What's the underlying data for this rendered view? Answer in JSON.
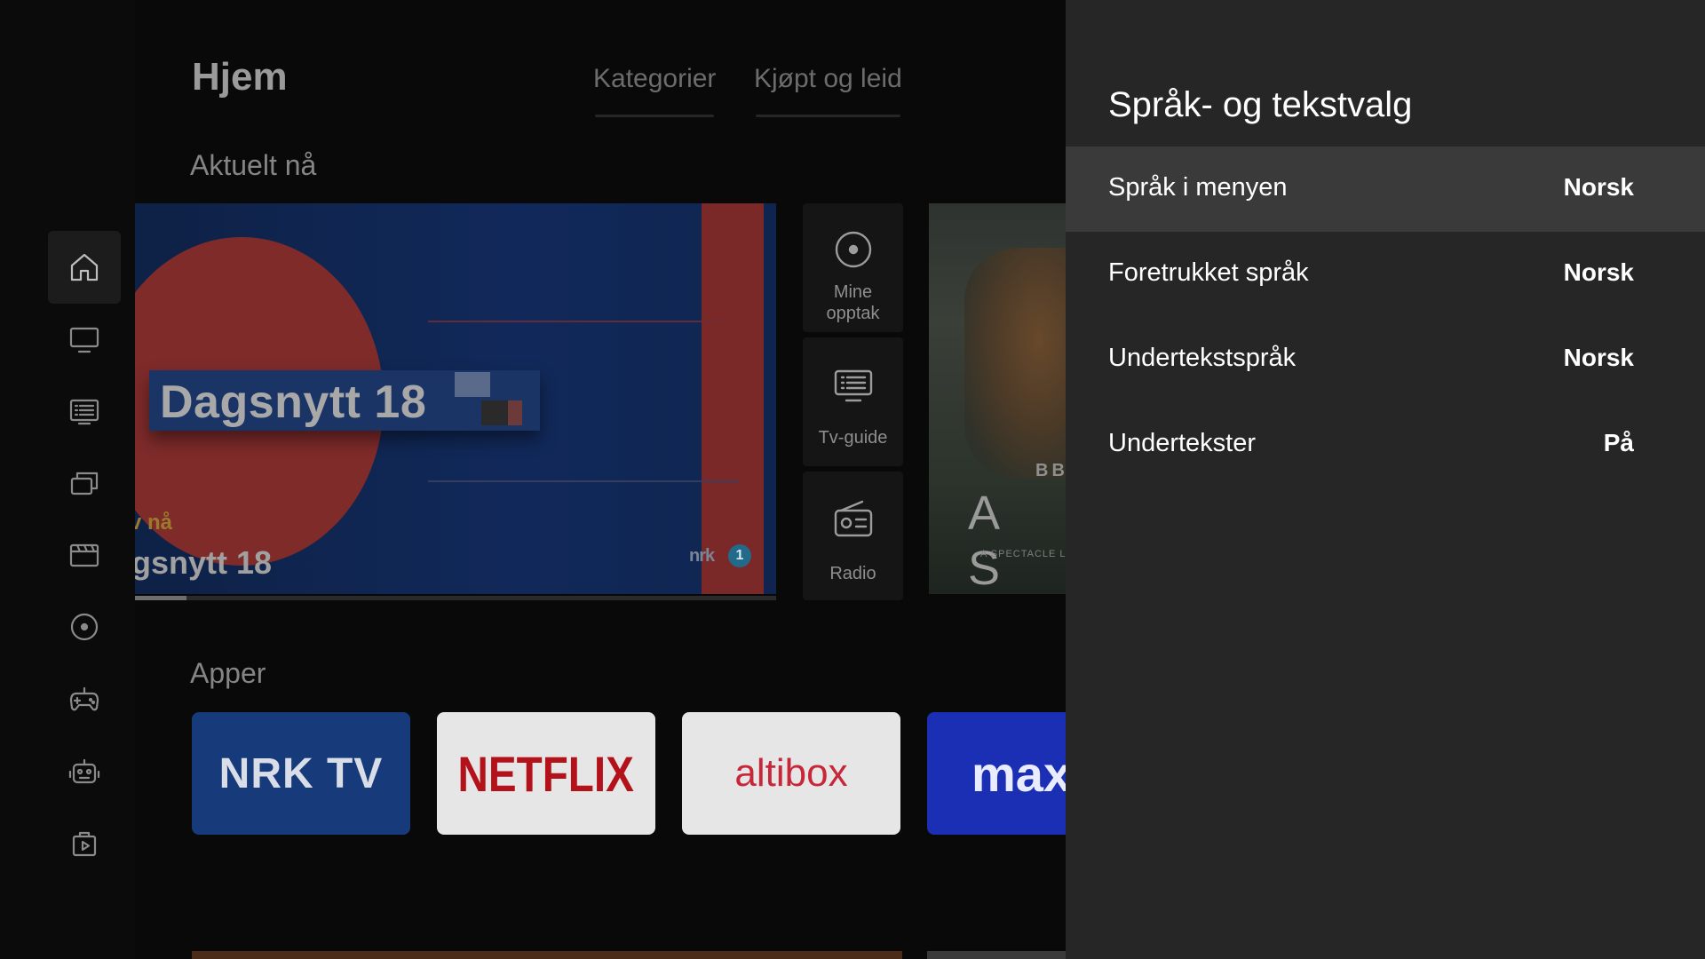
{
  "home": {
    "title": "Hjem",
    "tabs": [
      "Kategorier",
      "Kjøpt og leid"
    ],
    "section_now": "Aktuelt nå",
    "section_apps": "Apper"
  },
  "hero": {
    "plate_text": "Dagsnytt 18",
    "live_label": "v nå",
    "show_title": "gsnytt 18",
    "channel_logo": "nrk",
    "channel_number": "1",
    "progress": 0.08
  },
  "shortcuts": [
    {
      "label": "Mine opptak",
      "icon": "record-icon"
    },
    {
      "label": "Tv-guide",
      "icon": "tv-guide-icon"
    },
    {
      "label": "Radio",
      "icon": "radio-icon"
    }
  ],
  "side_card": {
    "network": "BBC",
    "title_partial": "A S",
    "tagline_partial": "A SPECTACLE L"
  },
  "apps": [
    {
      "name": "NRK TV",
      "bg": "#173a7a",
      "fg": "#d8dde8"
    },
    {
      "name": "NETFLIX",
      "bg": "#e6e6e6",
      "fg": "#b3121a"
    },
    {
      "name": "altibox",
      "bg": "#e6e6e6",
      "fg": "#c8273a"
    },
    {
      "name": "max",
      "bg": "#1b2fb5",
      "fg": "#e9ecff"
    }
  ],
  "rail": [
    {
      "name": "home",
      "icon": "home-icon",
      "active": true
    },
    {
      "name": "tv",
      "icon": "tv-icon"
    },
    {
      "name": "guide",
      "icon": "guide-icon"
    },
    {
      "name": "library",
      "icon": "stack-icon"
    },
    {
      "name": "movies",
      "icon": "clapper-icon"
    },
    {
      "name": "recordings",
      "icon": "record-icon"
    },
    {
      "name": "games",
      "icon": "gamepad-icon"
    },
    {
      "name": "kids",
      "icon": "robot-icon"
    },
    {
      "name": "store",
      "icon": "bag-play-icon"
    }
  ],
  "panel": {
    "title": "Språk- og tekstvalg",
    "rows": [
      {
        "label": "Språk i menyen",
        "value": "Norsk",
        "focused": true
      },
      {
        "label": "Foretrukket språk",
        "value": "Norsk"
      },
      {
        "label": "Undertekstspråk",
        "value": "Norsk"
      },
      {
        "label": "Undertekster",
        "value": "På"
      }
    ]
  },
  "colors": {
    "panel_bg": "#262626",
    "focused_row": "#3a3a3a",
    "rail_bg": "#0b0b0b"
  }
}
